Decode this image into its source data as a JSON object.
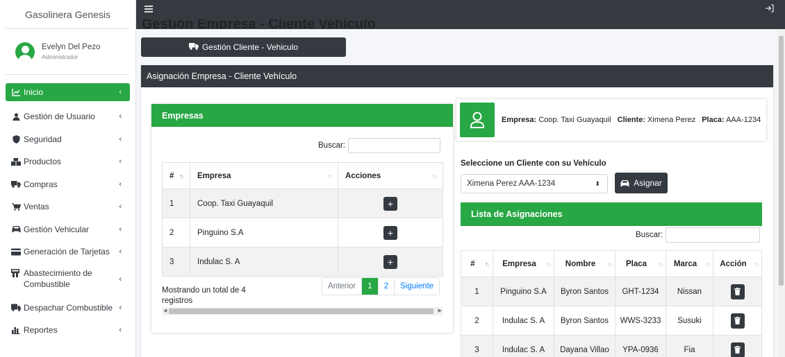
{
  "brand": "Gasolinera Genesis",
  "user": {
    "name": "Evelyn Del Pezo",
    "role": "Administrador"
  },
  "nav": [
    {
      "label": "Inicio",
      "icon": "chart-line-icon"
    },
    {
      "label": "Gestión de Usuario",
      "icon": "user-icon"
    },
    {
      "label": "Seguridad",
      "icon": "shield-icon"
    },
    {
      "label": "Productos",
      "icon": "boxes-icon"
    },
    {
      "label": "Compras",
      "icon": "truck-icon"
    },
    {
      "label": "Ventas",
      "icon": "cart-icon"
    },
    {
      "label": "Gestión Vehicular",
      "icon": "car-icon"
    },
    {
      "label": "Generación de Tarjetas",
      "icon": "credit-card-icon"
    },
    {
      "label": "Abastecimiento de Combustible",
      "icon": "fuel-station-icon"
    },
    {
      "label": "Despachar Combustible",
      "icon": "fuel-truck-icon"
    },
    {
      "label": "Reportes",
      "icon": "bar-chart-icon"
    }
  ],
  "page": {
    "heading_partial": "Gestión Empresa - Cliente Vehículo",
    "top_button": "Gestión Cliente - Vehiculo",
    "card_title": "Asignación Empresa - Cliente Vehículo"
  },
  "empresas": {
    "title": "Empresas",
    "search_label": "Buscar:",
    "columns": [
      "#",
      "Empresa",
      "Acciones"
    ],
    "rows": [
      {
        "n": "1",
        "empresa": "Coop. Taxi Guayaquil"
      },
      {
        "n": "2",
        "empresa": "Pinguino S.A"
      },
      {
        "n": "3",
        "empresa": "Indulac S. A"
      }
    ],
    "info": "Mostrando un total de 4 registros",
    "pager": {
      "prev": "Anterior",
      "p1": "1",
      "p2": "2",
      "next": "Siguiente"
    }
  },
  "selected": {
    "empresa_label": "Empresa:",
    "empresa": "Coop. Taxi Guayaquil",
    "cliente_label": "Cliente:",
    "cliente": "Ximena Perez",
    "placa_label": "Placa:",
    "placa": "AAA-1234"
  },
  "selector": {
    "label": "Seleccione un Cliente con su Vehículo",
    "value": "Ximena Perez AAA-1234",
    "button": "Asignar"
  },
  "asignaciones": {
    "title": "Lista de Asignaciones",
    "search_label": "Buscar:",
    "columns": [
      "#",
      "Empresa",
      "Nombre",
      "Placa",
      "Marca",
      "Acción"
    ],
    "rows": [
      {
        "n": "1",
        "empresa": "Pinguino S.A",
        "nombre": "Byron Santos",
        "placa": "GHT-1234",
        "marca": "Nissan"
      },
      {
        "n": "2",
        "empresa": "Indulac S. A",
        "nombre": "Byron Santos",
        "placa": "WWS-3233",
        "marca": "Susuki"
      },
      {
        "n": "3",
        "empresa": "Indulac S. A",
        "nombre": "Dayana Villao",
        "placa": "YPA-0936",
        "marca": "Fia"
      }
    ]
  },
  "colors": {
    "green": "#28a745",
    "dark": "#343a40"
  }
}
